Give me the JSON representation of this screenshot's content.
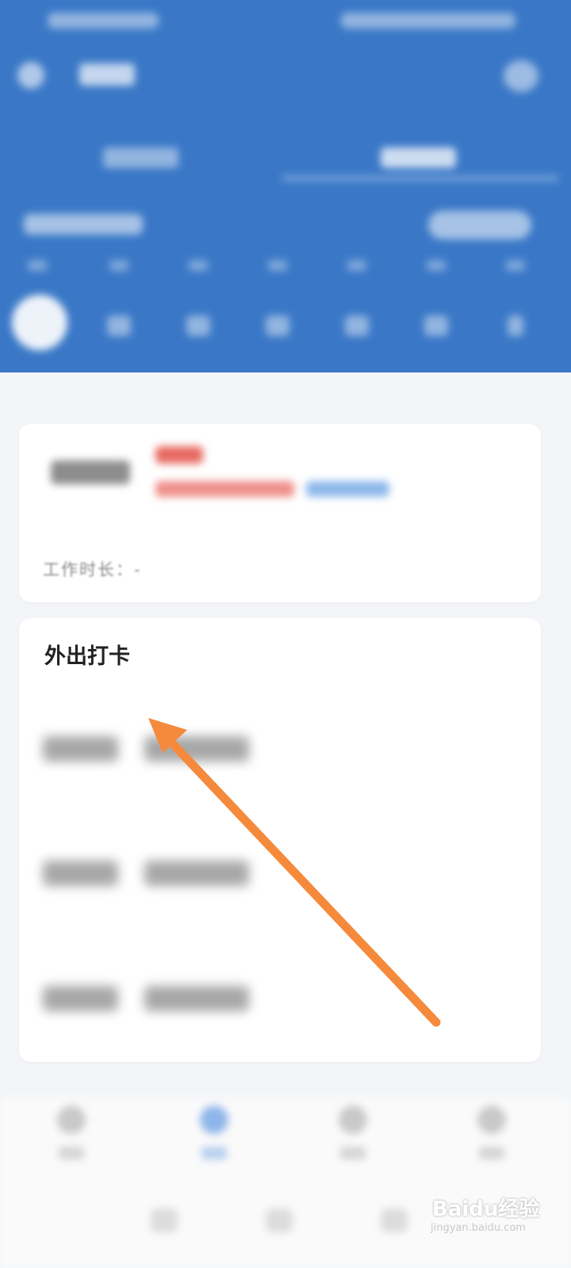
{
  "header": {
    "title": "",
    "tabs": [
      "",
      ""
    ],
    "week_days": [
      "",
      "",
      "",
      "",
      "",
      "",
      ""
    ]
  },
  "summary_card": {
    "work_duration_label": "工作时长：",
    "work_duration_value": "-"
  },
  "outing_card": {
    "title": "外出打卡",
    "records": [
      {
        "time": "",
        "label": ""
      },
      {
        "time": "",
        "label": ""
      },
      {
        "time": "",
        "label": ""
      }
    ]
  },
  "colors": {
    "header_bg": "#3a78c7",
    "accent_red": "#e86a63",
    "accent_blue": "#8db8ea",
    "arrow": "#f58a3c"
  },
  "bottom_nav": {
    "items": [
      "",
      "",
      "",
      ""
    ],
    "active_index": 1
  },
  "watermark": {
    "text": "Baidu经验",
    "sub": "jingyan.baidu.com"
  }
}
